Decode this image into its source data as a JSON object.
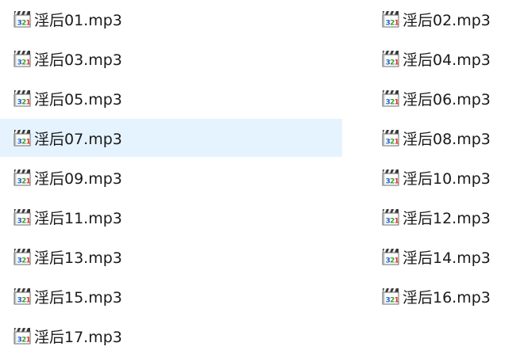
{
  "file_list": {
    "icon": "media-player-file-icon",
    "colors": {
      "selection": "#e5f3ff",
      "text": "#1a1a1a"
    },
    "items": [
      {
        "name": "淫后01.mp3",
        "column": "left",
        "row": 0,
        "selected": false
      },
      {
        "name": "淫后02.mp3",
        "column": "right",
        "row": 0,
        "selected": false
      },
      {
        "name": "淫后03.mp3",
        "column": "left",
        "row": 1,
        "selected": false
      },
      {
        "name": "淫后04.mp3",
        "column": "right",
        "row": 1,
        "selected": false
      },
      {
        "name": "淫后05.mp3",
        "column": "left",
        "row": 2,
        "selected": false
      },
      {
        "name": "淫后06.mp3",
        "column": "right",
        "row": 2,
        "selected": false
      },
      {
        "name": "淫后07.mp3",
        "column": "left",
        "row": 3,
        "selected": true
      },
      {
        "name": "淫后08.mp3",
        "column": "right",
        "row": 3,
        "selected": false
      },
      {
        "name": "淫后09.mp3",
        "column": "left",
        "row": 4,
        "selected": false
      },
      {
        "name": "淫后10.mp3",
        "column": "right",
        "row": 4,
        "selected": false
      },
      {
        "name": "淫后11.mp3",
        "column": "left",
        "row": 5,
        "selected": false
      },
      {
        "name": "淫后12.mp3",
        "column": "right",
        "row": 5,
        "selected": false
      },
      {
        "name": "淫后13.mp3",
        "column": "left",
        "row": 6,
        "selected": false
      },
      {
        "name": "淫后14.mp3",
        "column": "right",
        "row": 6,
        "selected": false
      },
      {
        "name": "淫后15.mp3",
        "column": "left",
        "row": 7,
        "selected": false
      },
      {
        "name": "淫后16.mp3",
        "column": "right",
        "row": 7,
        "selected": false
      },
      {
        "name": "淫后17.mp3",
        "column": "left",
        "row": 8,
        "selected": false
      }
    ]
  }
}
